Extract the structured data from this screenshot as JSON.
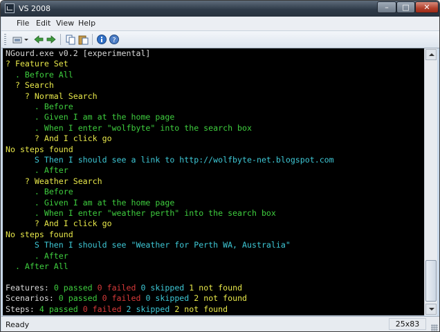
{
  "window": {
    "title": "VS 2008"
  },
  "menu": [
    "File",
    "Edit",
    "View",
    "Help"
  ],
  "toolbar": {
    "icons": [
      "new-icon",
      "dropdown-arrow-icon",
      "back-icon",
      "forward-icon",
      "copy-icon",
      "paste-icon",
      "info-icon",
      "help-icon"
    ]
  },
  "colors": {
    "white": "#d8d8d8",
    "yellow": "#e8e84a",
    "green": "#3fcf3f",
    "cyan": "#3ec8d6",
    "red": "#d83a3a"
  },
  "console": {
    "lines": [
      [
        {
          "t": "NGourd.exe v0.2 [experimental]",
          "c": "white"
        }
      ],
      [
        {
          "t": "? Feature Set",
          "c": "yellow"
        }
      ],
      [
        {
          "t": "  . Before All",
          "c": "green"
        }
      ],
      [
        {
          "t": "  ? Search",
          "c": "yellow"
        }
      ],
      [
        {
          "t": "    ? Normal Search",
          "c": "yellow"
        }
      ],
      [
        {
          "t": "      . Before",
          "c": "green"
        }
      ],
      [
        {
          "t": "      . Given I am at the home page",
          "c": "green"
        }
      ],
      [
        {
          "t": "      . When I enter \"wolfbyte\" into the search box",
          "c": "green"
        }
      ],
      [
        {
          "t": "      ? And I click go",
          "c": "yellow"
        }
      ],
      [
        {
          "t": "No steps found",
          "c": "yellow"
        }
      ],
      [
        {
          "t": "      S Then I should see a link to http://wolfbyte-net.blogspot.com",
          "c": "cyan"
        }
      ],
      [
        {
          "t": "      . After",
          "c": "green"
        }
      ],
      [
        {
          "t": "    ? Weather Search",
          "c": "yellow"
        }
      ],
      [
        {
          "t": "      . Before",
          "c": "green"
        }
      ],
      [
        {
          "t": "      . Given I am at the home page",
          "c": "green"
        }
      ],
      [
        {
          "t": "      . When I enter \"weather perth\" into the search box",
          "c": "green"
        }
      ],
      [
        {
          "t": "      ? And I click go",
          "c": "yellow"
        }
      ],
      [
        {
          "t": "No steps found",
          "c": "yellow"
        }
      ],
      [
        {
          "t": "      S Then I should see \"Weather for Perth WA, Australia\"",
          "c": "cyan"
        }
      ],
      [
        {
          "t": "      . After",
          "c": "green"
        }
      ],
      [
        {
          "t": "  . After All",
          "c": "green"
        }
      ],
      [],
      [
        {
          "t": "Features: ",
          "c": "white"
        },
        {
          "t": "0 passed ",
          "c": "green"
        },
        {
          "t": "0 failed ",
          "c": "red"
        },
        {
          "t": "0 skipped ",
          "c": "cyan"
        },
        {
          "t": "1 not found",
          "c": "yellow"
        }
      ],
      [
        {
          "t": "Scenarios: ",
          "c": "white"
        },
        {
          "t": "0 passed ",
          "c": "green"
        },
        {
          "t": "0 failed ",
          "c": "red"
        },
        {
          "t": "0 skipped ",
          "c": "cyan"
        },
        {
          "t": "2 not found",
          "c": "yellow"
        }
      ],
      [
        {
          "t": "Steps: ",
          "c": "white"
        },
        {
          "t": "4 passed ",
          "c": "green"
        },
        {
          "t": "0 failed ",
          "c": "red"
        },
        {
          "t": "2 skipped ",
          "c": "cyan"
        },
        {
          "t": "2 not found",
          "c": "yellow"
        }
      ]
    ]
  },
  "status": {
    "text": "Ready",
    "size": "25x83"
  }
}
